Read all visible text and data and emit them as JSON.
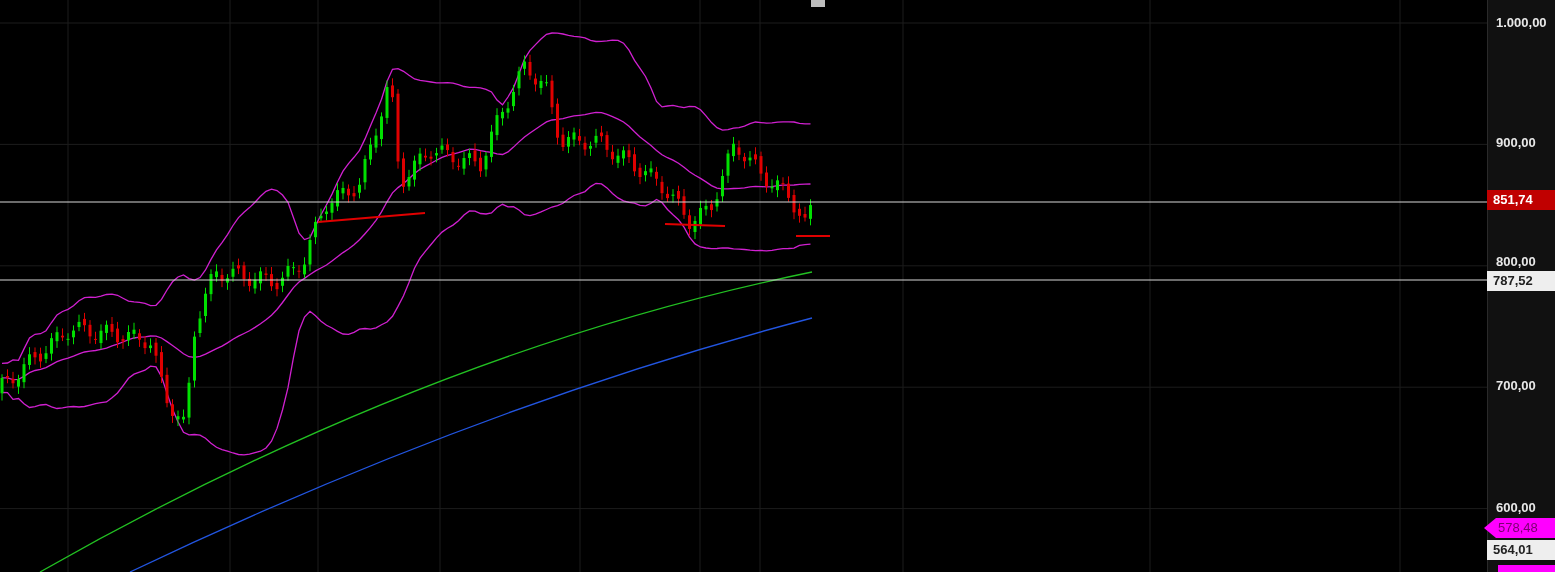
{
  "price_axis": {
    "labels": [
      "1.000,00",
      "900,00",
      "800,00",
      "700,00",
      "600,00"
    ]
  },
  "price_tags": [
    {
      "text": "851,74",
      "kind": "box",
      "color": "#c00000"
    },
    {
      "text": "787,52",
      "kind": "box",
      "color": "#eeeeee"
    },
    {
      "text": "578,48",
      "kind": "arrow",
      "color": "#ff00ff"
    },
    {
      "text": "564,01",
      "kind": "box",
      "color": "#eeeeee"
    }
  ]
}
